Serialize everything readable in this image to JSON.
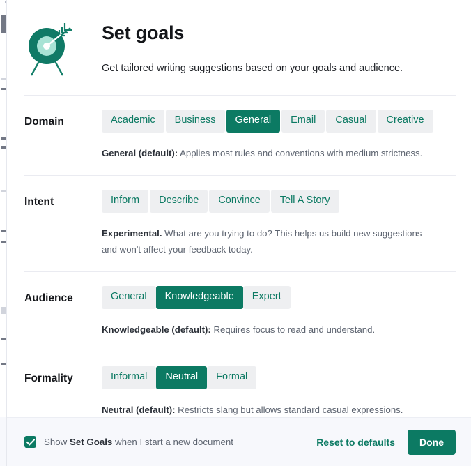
{
  "dialog": {
    "icon": "target-goal-icon",
    "title": "Set goals",
    "subtitle": "Get tailored writing suggestions based on your goals and audience.",
    "accent_color": "#0c7a63",
    "chip_bg_color": "#eeeff1",
    "footer_bg_color": "#f7f8fc"
  },
  "sections": [
    {
      "label": "Domain",
      "options": [
        {
          "label": "Academic",
          "selected": false
        },
        {
          "label": "Business",
          "selected": false
        },
        {
          "label": "General",
          "selected": true
        },
        {
          "label": "Email",
          "selected": false
        },
        {
          "label": "Casual",
          "selected": false
        },
        {
          "label": "Creative",
          "selected": false
        }
      ],
      "desc_bold": "General (default):",
      "desc_rest": " Applies most rules and conventions with medium strictness."
    },
    {
      "label": "Intent",
      "options": [
        {
          "label": "Inform",
          "selected": false
        },
        {
          "label": "Describe",
          "selected": false
        },
        {
          "label": "Convince",
          "selected": false
        },
        {
          "label": "Tell A Story",
          "selected": false
        }
      ],
      "desc_bold": "Experimental.",
      "desc_rest": " What are you trying to do? This helps us build new suggestions and won't affect your feedback today."
    },
    {
      "label": "Audience",
      "options": [
        {
          "label": "General",
          "selected": false
        },
        {
          "label": "Knowledgeable",
          "selected": true
        },
        {
          "label": "Expert",
          "selected": false
        }
      ],
      "desc_bold": "Knowledgeable (default):",
      "desc_rest": " Requires focus to read and understand."
    },
    {
      "label": "Formality",
      "options": [
        {
          "label": "Informal",
          "selected": false
        },
        {
          "label": "Neutral",
          "selected": true
        },
        {
          "label": "Formal",
          "selected": false
        }
      ],
      "desc_bold": "Neutral (default):",
      "desc_rest": " Restricts slang but allows standard casual expressions."
    }
  ],
  "footer": {
    "checkbox_checked": true,
    "checkbox_icon": "checkmark-icon",
    "label_pre": "Show ",
    "label_bold": "Set Goals",
    "label_post": " when I start a new document",
    "reset_label": "Reset to defaults",
    "done_label": "Done"
  }
}
